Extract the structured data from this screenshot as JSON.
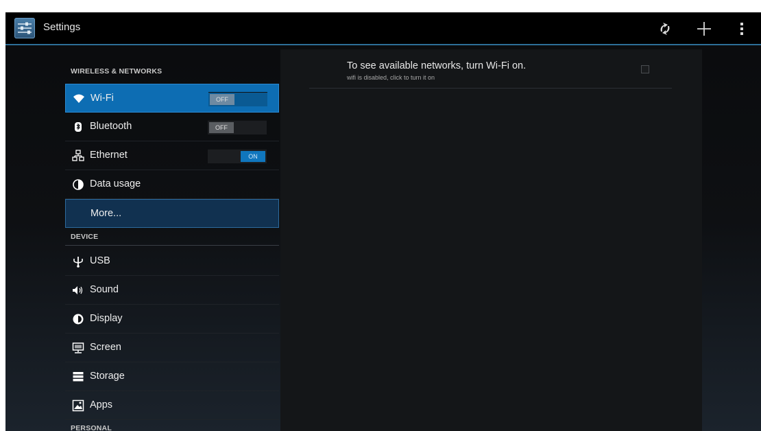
{
  "actionbar": {
    "title": "Settings",
    "app_icon": "settings-sliders-icon",
    "actions": [
      {
        "name": "sync-icon"
      },
      {
        "name": "add-icon"
      },
      {
        "name": "overflow-menu-icon"
      }
    ]
  },
  "sections": {
    "wireless": "WIRELESS & NETWORKS",
    "device": "DEVICE",
    "personal": "PERSONAL"
  },
  "items": {
    "wifi": {
      "label": "Wi-Fi",
      "icon": "wifi-icon",
      "toggle": "OFF"
    },
    "bluetooth": {
      "label": "Bluetooth",
      "icon": "bluetooth-icon",
      "toggle": "OFF"
    },
    "ethernet": {
      "label": "Ethernet",
      "icon": "ethernet-icon",
      "toggle": "ON"
    },
    "data_usage": {
      "label": "Data usage",
      "icon": "data-usage-icon"
    },
    "more": {
      "label": "More..."
    },
    "usb": {
      "label": "USB",
      "icon": "usb-icon"
    },
    "sound": {
      "label": "Sound",
      "icon": "speaker-icon"
    },
    "display": {
      "label": "Display",
      "icon": "display-brightness-icon"
    },
    "screen": {
      "label": "Screen",
      "icon": "monitor-icon"
    },
    "storage": {
      "label": "Storage",
      "icon": "storage-icon"
    },
    "apps": {
      "label": "Apps",
      "icon": "apps-icon"
    }
  },
  "wifi_panel": {
    "title": "To see available networks, turn Wi-Fi on.",
    "subtitle": "wifi is disabled, click to turn it on"
  },
  "colors": {
    "accent": "#0d6db3",
    "actionbar_border": "#2d6e97",
    "toggle_on": "#1076bd"
  }
}
